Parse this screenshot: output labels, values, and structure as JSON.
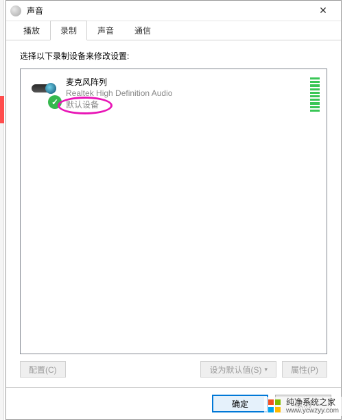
{
  "window": {
    "title": "声音",
    "close": "✕"
  },
  "tabs": [
    "播放",
    "录制",
    "声音",
    "通信"
  ],
  "activeTab": 1,
  "instruction": "选择以下录制设备来修改设置:",
  "device": {
    "name": "麦克风阵列",
    "driver": "Realtek High Definition Audio",
    "status": "默认设备"
  },
  "buttons": {
    "configure": "配置(C)",
    "setDefault": "设为默认值(S)",
    "properties": "属性(P)",
    "ok": "确定",
    "cancel": "取消"
  },
  "watermark": {
    "name": "纯净系统之家",
    "url": "www.ycwzyy.com"
  }
}
